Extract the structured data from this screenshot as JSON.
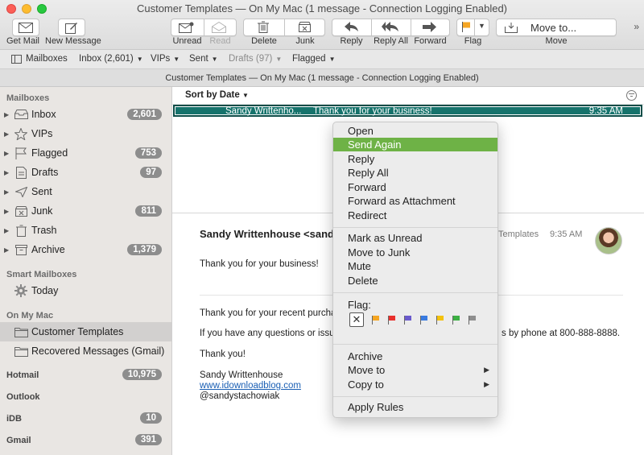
{
  "window": {
    "title": "Customer Templates — On My Mac (1 message - Connection Logging Enabled)"
  },
  "toolbar": {
    "get_mail": "Get Mail",
    "new_message": "New Message",
    "unread": "Unread",
    "read": "Read",
    "delete": "Delete",
    "junk": "Junk",
    "reply": "Reply",
    "reply_all": "Reply All",
    "forward": "Forward",
    "flag": "Flag",
    "move_to": "Move to...",
    "move": "Move",
    "flag_color": "#f5a623"
  },
  "favorites": {
    "mailboxes": "Mailboxes",
    "inbox": "Inbox (2,601)",
    "vips": "VIPs",
    "sent": "Sent",
    "drafts": "Drafts (97)",
    "flagged": "Flagged"
  },
  "pathbar": {
    "title": "Customer Templates — On My Mac (1 message - Connection Logging Enabled)"
  },
  "sidebar": {
    "mailboxes_header": "Mailboxes",
    "items": [
      {
        "label": "Inbox",
        "badge": "2,601",
        "icon": "inbox-icon"
      },
      {
        "label": "VIPs",
        "badge": "",
        "icon": "star-icon"
      },
      {
        "label": "Flagged",
        "badge": "753",
        "icon": "flag-icon"
      },
      {
        "label": "Drafts",
        "badge": "97",
        "icon": "drafts-icon"
      },
      {
        "label": "Sent",
        "badge": "",
        "icon": "sent-icon"
      },
      {
        "label": "Junk",
        "badge": "811",
        "icon": "junk-icon"
      },
      {
        "label": "Trash",
        "badge": "",
        "icon": "trash-icon"
      },
      {
        "label": "Archive",
        "badge": "1,379",
        "icon": "archive-icon"
      }
    ],
    "smart_header": "Smart Mailboxes",
    "today": "Today",
    "onmymac_header": "On My Mac",
    "customer_templates": "Customer Templates",
    "recovered": "Recovered Messages (Gmail)",
    "accounts": [
      {
        "label": "Hotmail",
        "badge": "10,975"
      },
      {
        "label": "Outlook",
        "badge": ""
      },
      {
        "label": "iDB",
        "badge": "10"
      },
      {
        "label": "Gmail",
        "badge": "391"
      }
    ]
  },
  "message_list": {
    "sort_label": "Sort by Date",
    "selected_color": "#16736c",
    "rows": [
      {
        "from": "Sandy Writtenho...",
        "subject": "Thank you for your business!",
        "time": "9:35 AM"
      }
    ]
  },
  "message_view": {
    "from": "Sandy Writtenhouse <sand",
    "mailbox": "Templates",
    "time": "9:35 AM",
    "subject_line": "Thank you for your business!",
    "body_1": "Thank you for your recent purcha",
    "body_2": "If you have any questions or issue",
    "body_2_tail": "s by phone at 800-888-8888.",
    "body_3": "Thank you!",
    "sig_name": "Sandy Writtenhouse",
    "sig_link": "www.idownloadblog.com",
    "sig_handle": "@sandystachowiak"
  },
  "context_menu": {
    "highlight_color": "#6eb246",
    "open": "Open",
    "send_again": "Send Again",
    "reply": "Reply",
    "reply_all": "Reply All",
    "forward": "Forward",
    "forward_attachment": "Forward as Attachment",
    "redirect": "Redirect",
    "mark_unread": "Mark as Unread",
    "move_junk": "Move to Junk",
    "mute": "Mute",
    "delete": "Delete",
    "flag_label": "Flag:",
    "flag_colors": [
      "#f5a623",
      "#e8302c",
      "#6a5acd",
      "#3a7be0",
      "#f4c20d",
      "#3cb043",
      "#8e8e8e"
    ],
    "archive": "Archive",
    "move_to": "Move to",
    "copy_to": "Copy to",
    "apply_rules": "Apply Rules"
  }
}
